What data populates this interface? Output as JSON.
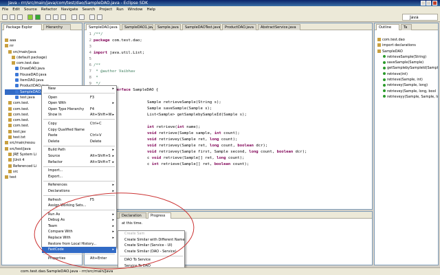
{
  "window": {
    "title": "Java - rrr/src/main/java/com/test/dao/SampleDAO.java - Eclipse SDK"
  },
  "menubar": [
    "File",
    "Edit",
    "Source",
    "Refactor",
    "Navigate",
    "Search",
    "Project",
    "Run",
    "Window",
    "Help"
  ],
  "perspective": {
    "label": "Java"
  },
  "left_panel": {
    "tabs": [
      "Package Explor",
      "Hierarchy"
    ],
    "tree": [
      "aaa",
      "rrr",
      "src/main/java",
      "(default package)",
      "com.test.dao",
      "DrawDAO.java",
      "HouseDAO.java",
      "ItemDAO.java",
      "ProductDAO.java",
      "SampleDAO.java",
      "test.java",
      "com.test.",
      "com.test.",
      "com.test.",
      "com.test.",
      "com.test.",
      "test.jav",
      "test.txt",
      "src/main/resou",
      "src/test/java",
      "JRE System Li",
      "JUnit 4",
      "Referenced Li",
      "src",
      "test"
    ]
  },
  "editor": {
    "tabs": [
      "SampleDAO.java",
      "SampleDAO1.java",
      "Sample.java",
      "SampleDAOTest.java",
      "ProductDAO.java",
      "AbstractService.java"
    ],
    "lines": [
      {
        "n": "1",
        "t": "/**/"
      },
      {
        "n": "2",
        "t": "package com.test.dao;"
      },
      {
        "n": "3",
        "t": ""
      },
      {
        "n": "4",
        "t": "import java.util.List;"
      },
      {
        "n": "5",
        "t": ""
      },
      {
        "n": "6",
        "t": "/**"
      },
      {
        "n": "7",
        "t": " * @author Vaibhav"
      },
      {
        "n": "8",
        "t": " *"
      },
      {
        "n": "9",
        "t": " */"
      },
      {
        "n": "10",
        "t": "public interface SampleDAO {"
      },
      {
        "n": "",
        "t": ""
      },
      {
        "n": "",
        "t": "Sample retrieveSample(String s);"
      },
      {
        "n": "",
        "t": "Sample saveSample(Sample s);"
      },
      {
        "n": "",
        "t": "List<Sample> getSamplebySampleId(Sample s);"
      },
      {
        "n": "",
        "t": ""
      },
      {
        "n": "",
        "t": "int retrieve(int name);"
      },
      {
        "n": "",
        "t": "void retrieve(Sample sample, int count);"
      },
      {
        "n": "",
        "t": "void retrievey(Sample ret, long count);"
      },
      {
        "n": "",
        "t": "void retrievey(Sample ret, long count, boolean dcr);"
      },
      {
        "n": "",
        "t": "void retrievey(Sample first, Sample second, long count, boolean dcr);"
      },
      {
        "n": "",
        "t": "c void retrieve(Sample[] ret, long count);"
      },
      {
        "n": "",
        "t": "c int retrieve(Sample[] ret, boolean count);"
      }
    ]
  },
  "outline": {
    "tabs": [
      "Outline",
      "Ta"
    ],
    "items": [
      "com.test.dao",
      "import declarations",
      "SampleDAO",
      "retrieveSample(String)",
      "saveSample(Sample)",
      "getSamplebySampleId(Sample)",
      "retrieve(int)",
      "retrieve(Sample, int)",
      "retrievey(Sample, long)",
      "retrievey(Sample, long, bool",
      "retrieveyy(Sample, Sample, lo"
    ]
  },
  "context_menu": {
    "items": [
      {
        "label": "New",
        "acc": "",
        "sub": true
      },
      {
        "sep": true
      },
      {
        "label": "Open",
        "acc": "F3"
      },
      {
        "label": "Open With",
        "acc": "",
        "sub": true
      },
      {
        "label": "Open Type Hierarchy",
        "acc": "F4"
      },
      {
        "label": "Show In",
        "acc": "Alt+Shift+W",
        "sub": true
      },
      {
        "sep": true
      },
      {
        "label": "Copy",
        "acc": "Ctrl+C"
      },
      {
        "label": "Copy Qualified Name",
        "acc": ""
      },
      {
        "label": "Paste",
        "acc": "Ctrl+V"
      },
      {
        "label": "Delete",
        "acc": "Delete"
      },
      {
        "sep": true
      },
      {
        "label": "Build Path",
        "acc": "",
        "sub": true
      },
      {
        "label": "Source",
        "acc": "Alt+Shift+S",
        "sub": true
      },
      {
        "label": "Refactor",
        "acc": "Alt+Shift+T",
        "sub": true
      },
      {
        "sep": true
      },
      {
        "label": "Import...",
        "acc": ""
      },
      {
        "label": "Export...",
        "acc": ""
      },
      {
        "sep": true
      },
      {
        "label": "References",
        "acc": "",
        "sub": true
      },
      {
        "label": "Declarations",
        "acc": "",
        "sub": true
      },
      {
        "sep": true
      },
      {
        "label": "Refresh",
        "acc": "F5"
      },
      {
        "label": "Assign Working Sets...",
        "acc": ""
      },
      {
        "sep": true
      },
      {
        "label": "Run As",
        "acc": "",
        "sub": true
      },
      {
        "label": "Debug As",
        "acc": "",
        "sub": true
      },
      {
        "label": "Team",
        "acc": "",
        "sub": true
      },
      {
        "label": "Compare With",
        "acc": "",
        "sub": true
      },
      {
        "label": "Replace With",
        "acc": "",
        "sub": true
      },
      {
        "label": "Restore from Local History...",
        "acc": ""
      },
      {
        "label": "FastCode",
        "acc": "",
        "sub": true,
        "hl": true
      },
      {
        "sep": true
      },
      {
        "label": "Properties",
        "acc": "Alt+Enter"
      }
    ]
  },
  "submenu": {
    "items": [
      {
        "label": "Create Sam",
        "dis": true
      },
      {
        "label": "Create Similar with Different Name"
      },
      {
        "label": "Create Similar (Service - UI)"
      },
      {
        "label": "Create Similar (DAO - Service)"
      },
      {
        "sep": true
      },
      {
        "label": "DAO To Service"
      },
      {
        "label": "Service To DAO"
      },
      {
        "label": "Jump to Hibernate mapping"
      }
    ]
  },
  "bottom_panel": {
    "tabs": [
      "Declaration",
      "Progress"
    ],
    "message": "at this time."
  },
  "statusbar": {
    "text": "com.test.dao.SampleDAO.java - rrr/src/main/java"
  }
}
